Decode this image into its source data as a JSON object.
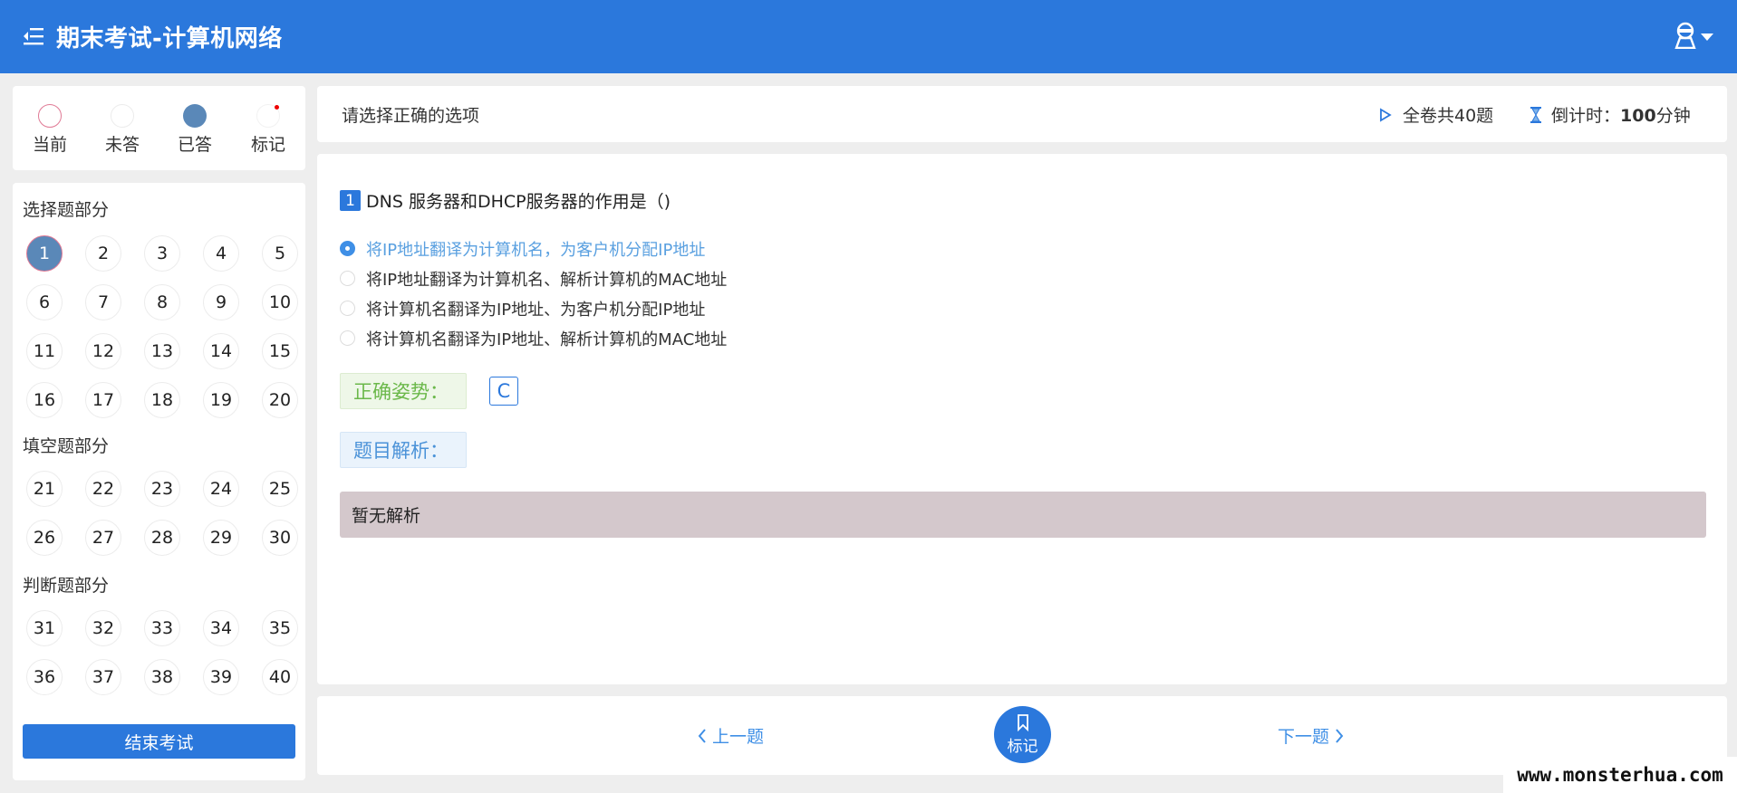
{
  "header": {
    "title": "期末考试-计算机网络"
  },
  "legend": [
    {
      "key": "current",
      "label": "当前"
    },
    {
      "key": "unanswered",
      "label": "未答"
    },
    {
      "key": "answered",
      "label": "已答"
    },
    {
      "key": "marked",
      "label": "标记"
    }
  ],
  "navigator": {
    "sections": [
      {
        "title": "选择题部分",
        "questions": [
          "1",
          "2",
          "3",
          "4",
          "5",
          "6",
          "7",
          "8",
          "9",
          "10",
          "11",
          "12",
          "13",
          "14",
          "15",
          "16",
          "17",
          "18",
          "19",
          "20"
        ]
      },
      {
        "title": "填空题部分",
        "questions": [
          "21",
          "22",
          "23",
          "24",
          "25",
          "26",
          "27",
          "28",
          "29",
          "30"
        ]
      },
      {
        "title": "判断题部分",
        "questions": [
          "31",
          "32",
          "33",
          "34",
          "35",
          "36",
          "37",
          "38",
          "39",
          "40"
        ]
      }
    ],
    "current_question": "1",
    "finish_label": "结束考试"
  },
  "info": {
    "instruction": "请选择正确的选项",
    "total": "全卷共40题",
    "timer_label": "倒计时：",
    "timer_value": "100",
    "timer_unit": "分钟"
  },
  "question": {
    "number": "1",
    "text": "DNS 服务器和DHCP服务器的作用是（)",
    "options": [
      {
        "text": "将IP地址翻译为计算机名，为客户机分配IP地址",
        "selected": true
      },
      {
        "text": "将IP地址翻译为计算机名、解析计算机的MAC地址",
        "selected": false
      },
      {
        "text": "将计算机名翻译为IP地址、为客户机分配IP地址",
        "selected": false
      },
      {
        "text": "将计算机名翻译为IP地址、解析计算机的MAC地址",
        "selected": false
      }
    ],
    "answer_label": "正确姿势：",
    "answer_value": "C",
    "analysis_label": "题目解析：",
    "analysis_text": "暂无解析"
  },
  "bottom_nav": {
    "prev_label": "上一题",
    "mark_label": "标记",
    "next_label": "下一题"
  },
  "watermark": "www.monsterhua.com",
  "colors": {
    "primary": "#2b78dc",
    "answered": "#5a88b8",
    "correct": "#6bb84a",
    "analysis": "#4a92d8",
    "analysis_bg": "#d4c8cc"
  },
  "icons": {
    "menu": "menu-icon",
    "user": "user-icon",
    "total": "play-icon",
    "timer": "hourglass-icon",
    "mark": "bookmark-icon",
    "prev": "chevron-left-icon",
    "next": "chevron-right-icon"
  }
}
